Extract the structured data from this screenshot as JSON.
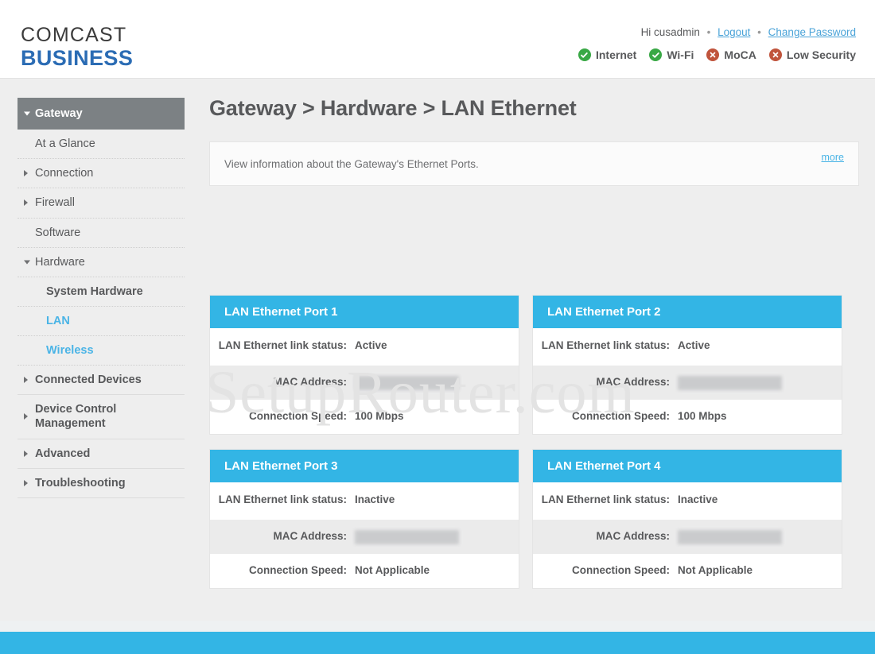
{
  "header": {
    "logo_top": "COMCAST",
    "logo_bottom": "BUSINESS",
    "greeting": "Hi cusadmin",
    "sep": "•",
    "logout_label": "Logout",
    "change_password_label": "Change Password",
    "status": [
      {
        "label": "Internet",
        "state": "ok",
        "icon": "check-circle-icon"
      },
      {
        "label": "Wi-Fi",
        "state": "ok",
        "icon": "check-circle-icon"
      },
      {
        "label": "MoCA",
        "state": "bad",
        "icon": "x-circle-icon"
      },
      {
        "label": "Low Security",
        "state": "bad",
        "icon": "x-circle-icon"
      }
    ]
  },
  "sidebar": {
    "items": [
      {
        "label": "Gateway",
        "level": "active-top",
        "caret": "down"
      },
      {
        "label": "At a Glance",
        "level": "sub",
        "caret": "none"
      },
      {
        "label": "Connection",
        "level": "sub-bold",
        "caret": "right"
      },
      {
        "label": "Firewall",
        "level": "sub-bold",
        "caret": "right"
      },
      {
        "label": "Software",
        "level": "sub",
        "caret": "none"
      },
      {
        "label": "Hardware",
        "level": "sub-bold",
        "caret": "down-dark"
      },
      {
        "label": "System Hardware",
        "level": "sub2",
        "caret": "none"
      },
      {
        "label": "LAN",
        "level": "sub2-link",
        "caret": "none"
      },
      {
        "label": "Wireless",
        "level": "sub2-link",
        "caret": "none"
      },
      {
        "label": "Connected Devices",
        "level": "top",
        "caret": "right"
      },
      {
        "label": "Device Control Management",
        "level": "top",
        "caret": "right"
      },
      {
        "label": "Advanced",
        "level": "top",
        "caret": "right"
      },
      {
        "label": "Troubleshooting",
        "level": "top",
        "caret": "right"
      }
    ]
  },
  "main": {
    "title": "Gateway > Hardware > LAN Ethernet",
    "info_text": "View information about the Gateway's Ethernet Ports.",
    "more_label": "more",
    "watermark": "SetupRouter.com",
    "row_labels": {
      "link_status": "LAN Ethernet link status:",
      "mac_address": "MAC Address:",
      "connection_speed": "Connection Speed:"
    },
    "cards": [
      {
        "title": "LAN Ethernet Port 1",
        "link_status": "Active",
        "mac_address": "",
        "mac_redacted": true,
        "connection_speed": "100 Mbps"
      },
      {
        "title": "LAN Ethernet Port 2",
        "link_status": "Active",
        "mac_address": "",
        "mac_redacted": true,
        "connection_speed": "100 Mbps"
      },
      {
        "title": "LAN Ethernet Port 3",
        "link_status": "Inactive",
        "mac_address": "",
        "mac_redacted": true,
        "connection_speed": "Not Applicable"
      },
      {
        "title": "LAN Ethernet Port 4",
        "link_status": "Inactive",
        "mac_address": "",
        "mac_redacted": true,
        "connection_speed": "Not Applicable"
      }
    ]
  },
  "colors": {
    "accent_blue": "#33b5e5",
    "link_blue": "#4ab4e6",
    "brand_blue": "#2b6cb4",
    "text_gray": "#58595b",
    "active_nav": "#7c8184",
    "status_ok": "#39a845",
    "status_bad": "#c0543c"
  }
}
